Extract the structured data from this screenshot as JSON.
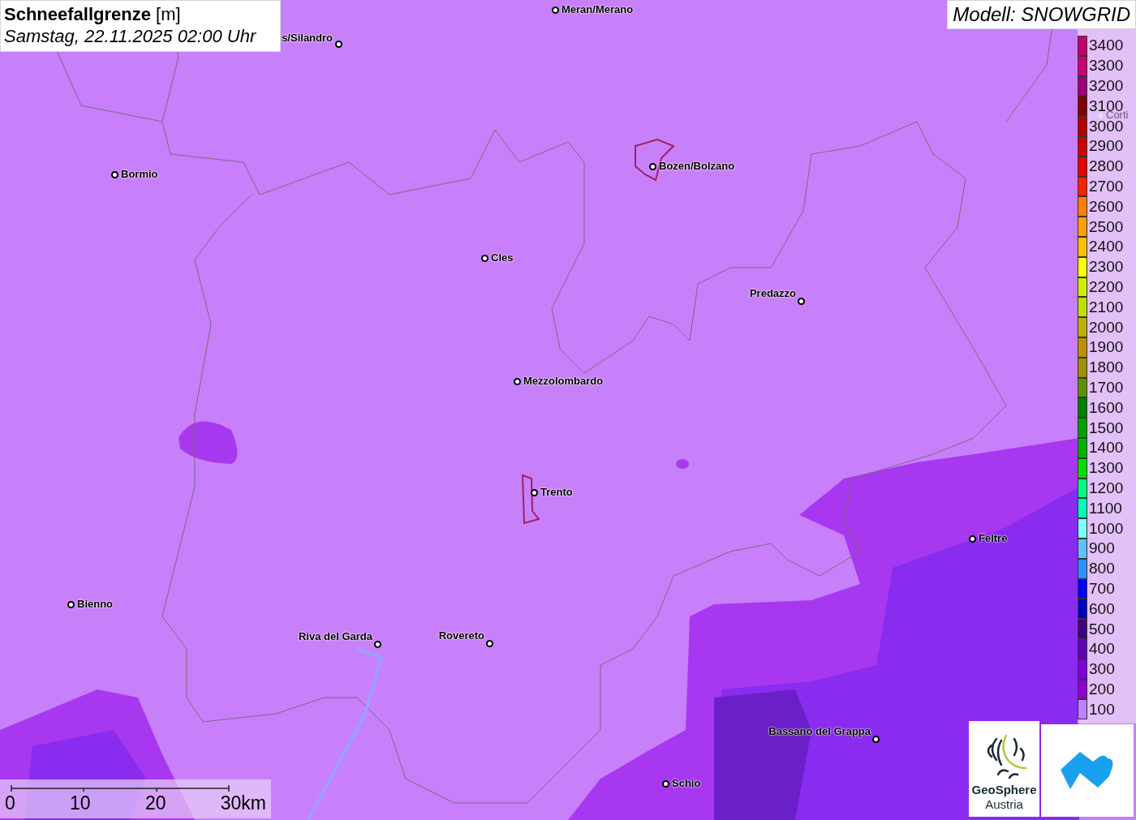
{
  "title": {
    "name": "Schneefallgrenze",
    "unit": "[m]",
    "datetime": "Samstag, 22.11.2025 02:00 Uhr"
  },
  "model": "Modell: SNOWGRID",
  "cities": [
    {
      "name": "Meran/Merano"
    },
    {
      "name": "s/Silandro"
    },
    {
      "name": "Bormio"
    },
    {
      "name": "Bozen/Bolzano"
    },
    {
      "name": "Cles"
    },
    {
      "name": "Predazzo"
    },
    {
      "name": "Mezzolombardo"
    },
    {
      "name": "Trento"
    },
    {
      "name": "Feltre"
    },
    {
      "name": "Bienno"
    },
    {
      "name": "Riva del Garda"
    },
    {
      "name": "Rovereto"
    },
    {
      "name": "Bassano del Grappa"
    },
    {
      "name": "Schio"
    },
    {
      "name": "Corti"
    }
  ],
  "legend": [
    {
      "label": "3400",
      "color": "#c4006c"
    },
    {
      "label": "3300",
      "color": "#cc0078"
    },
    {
      "label": "3200",
      "color": "#a0007c"
    },
    {
      "label": "3100",
      "color": "#800000"
    },
    {
      "label": "3000",
      "color": "#b40000"
    },
    {
      "label": "2900",
      "color": "#d00000"
    },
    {
      "label": "2800",
      "color": "#e80000"
    },
    {
      "label": "2700",
      "color": "#ff2000"
    },
    {
      "label": "2600",
      "color": "#ff8000"
    },
    {
      "label": "2500",
      "color": "#ffa000"
    },
    {
      "label": "2400",
      "color": "#ffc000"
    },
    {
      "label": "2300",
      "color": "#ffff00"
    },
    {
      "label": "2200",
      "color": "#d0f000"
    },
    {
      "label": "2100",
      "color": "#c0e000"
    },
    {
      "label": "2000",
      "color": "#c0b000"
    },
    {
      "label": "1900",
      "color": "#c09000"
    },
    {
      "label": "1800",
      "color": "#a09000"
    },
    {
      "label": "1700",
      "color": "#609000"
    },
    {
      "label": "1600",
      "color": "#008000"
    },
    {
      "label": "1500",
      "color": "#00a000"
    },
    {
      "label": "1400",
      "color": "#00b400"
    },
    {
      "label": "1300",
      "color": "#00e000"
    },
    {
      "label": "1200",
      "color": "#00ff80"
    },
    {
      "label": "1100",
      "color": "#00ffc0"
    },
    {
      "label": "1000",
      "color": "#80ffff"
    },
    {
      "label": "900",
      "color": "#60c0ff"
    },
    {
      "label": "800",
      "color": "#3090ff"
    },
    {
      "label": "700",
      "color": "#0000ff"
    },
    {
      "label": "600",
      "color": "#0000c0"
    },
    {
      "label": "500",
      "color": "#400080"
    },
    {
      "label": "400",
      "color": "#6000b0"
    },
    {
      "label": "300",
      "color": "#8000e0"
    },
    {
      "label": "200",
      "color": "#9000d0"
    },
    {
      "label": "100",
      "color": "#c080ff"
    }
  ],
  "scale": [
    "0",
    "10",
    "20",
    "30km"
  ],
  "logos": {
    "name": "GeoSphere",
    "sub": "Austria"
  }
}
